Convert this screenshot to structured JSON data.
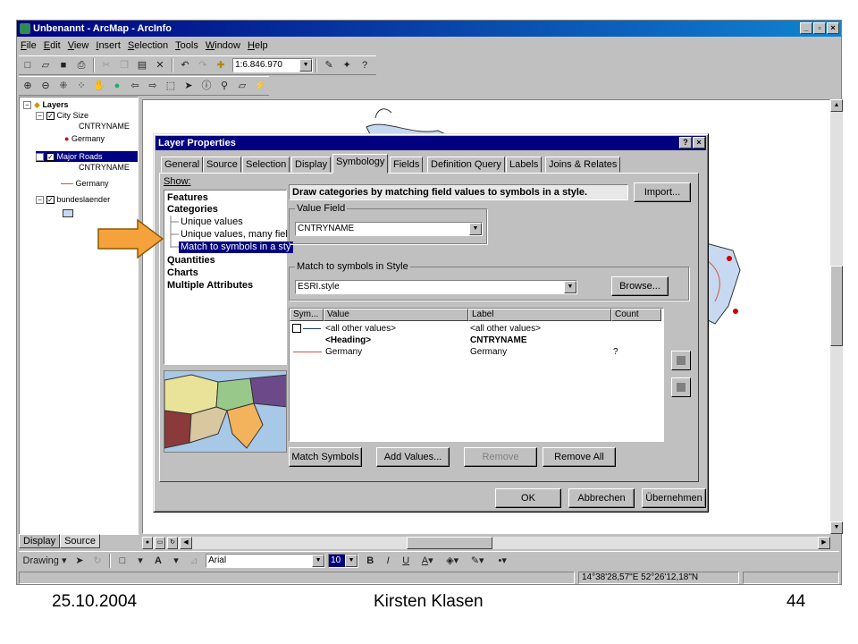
{
  "window": {
    "title": "Unbenannt - ArcMap - ArcInfo",
    "caption_buttons": [
      "_",
      "▫",
      "×"
    ]
  },
  "menu": [
    "File",
    "Edit",
    "View",
    "Insert",
    "Selection",
    "Tools",
    "Window",
    "Help"
  ],
  "toolbar": {
    "scale": "1:6.846.970"
  },
  "toc": {
    "root": "Layers",
    "layers": [
      {
        "name": "City Size",
        "field": "CNTRYNAME",
        "symbol_label": "Germany"
      },
      {
        "name": "Major Roads",
        "field": "CNTRYNAME",
        "symbol_label": "Germany"
      },
      {
        "name": "bundeslaender"
      }
    ],
    "tabs": [
      "Display",
      "Source"
    ]
  },
  "dialog": {
    "title": "Layer Properties",
    "tabs": [
      "General",
      "Source",
      "Selection",
      "Display",
      "Symbology",
      "Fields",
      "Definition Query",
      "Labels",
      "Joins & Relates"
    ],
    "show_label": "Show:",
    "show_items": [
      {
        "label": "Features",
        "bold": true
      },
      {
        "label": "Categories",
        "bold": true
      },
      {
        "label": "Unique values",
        "bold": false
      },
      {
        "label": "Unique values, many fiel",
        "bold": false
      },
      {
        "label": "Match to symbols in a sty",
        "bold": false,
        "selected": true
      },
      {
        "label": "Quantities",
        "bold": true
      },
      {
        "label": "Charts",
        "bold": true
      },
      {
        "label": "Multiple Attributes",
        "bold": true
      }
    ],
    "description": "Draw categories by matching field values to symbols in a style.",
    "import_button": "Import...",
    "value_field_label": "Value Field",
    "value_field": "CNTRYNAME",
    "match_label": "Match to symbols in Style",
    "style": "ESRI.style",
    "browse_button": "Browse...",
    "table_headers": [
      "Sym...",
      "Value",
      "Label",
      "Count"
    ],
    "table_rows": [
      {
        "value": "<all other values>",
        "label": "<all other values>",
        "count": ""
      },
      {
        "value": "<Heading>",
        "label": "CNTRYNAME",
        "count": ""
      },
      {
        "value": "Germany",
        "label": "Germany",
        "count": "?"
      }
    ],
    "buttons": {
      "match_symbols": "Match Symbols",
      "add_values": "Add Values...",
      "remove": "Remove",
      "remove_all": "Remove All"
    },
    "footer_buttons": {
      "ok": "OK",
      "cancel": "Abbrechen",
      "apply": "Übernehmen"
    }
  },
  "drawing_bar": {
    "drawing": "Drawing",
    "font": "Arial",
    "size": "10"
  },
  "status": {
    "coords": "14°38'28,57\"E  52°26'12,18\"N"
  },
  "slide_footer": {
    "date": "25.10.2004",
    "author": "Kirsten Klasen",
    "page": "44"
  },
  "colors": {
    "titlebar": "#000080",
    "selection": "#000080",
    "arrow": "#f5a23d",
    "arrow_border": "#8a5a00",
    "road_line": "#d2553a"
  }
}
